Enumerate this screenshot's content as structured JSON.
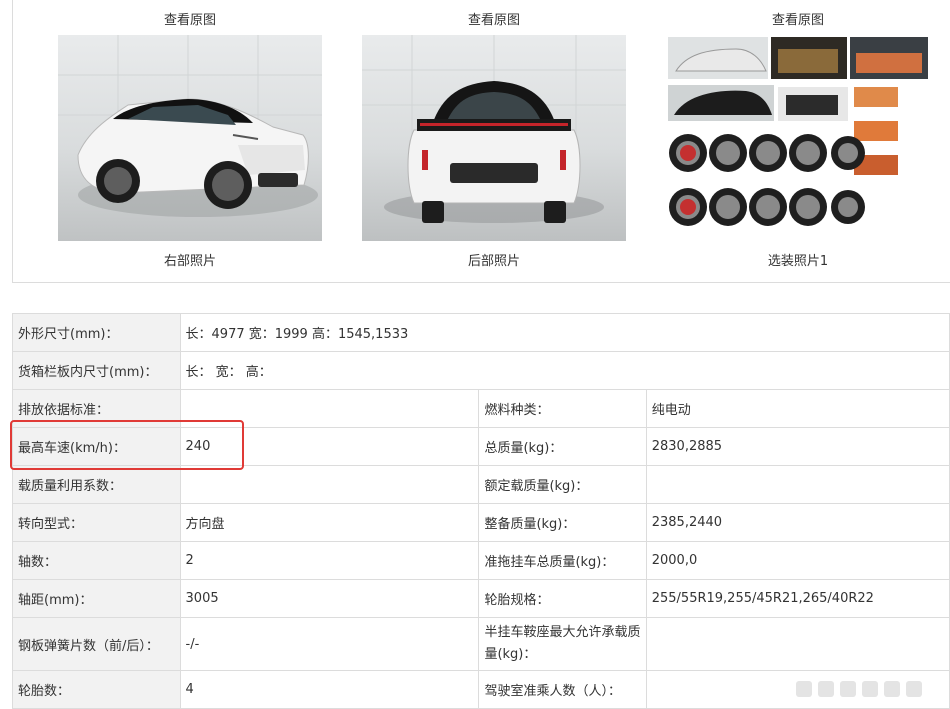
{
  "gallery": [
    {
      "view_link": "查看原图",
      "caption": "右部照片"
    },
    {
      "view_link": "查看原图",
      "caption": "后部照片"
    },
    {
      "view_link": "查看原图",
      "caption": "选装照片1"
    }
  ],
  "specs": {
    "rows": [
      {
        "l1": "外形尺寸(mm)：",
        "v1": "长：4977 宽：1999 高：1545,1533"
      },
      {
        "l1": "货箱栏板内尺寸(mm)：",
        "v1": "长： 宽： 高："
      },
      {
        "l1": "排放依据标准：",
        "v1": "",
        "l2": "燃料种类：",
        "v2": "纯电动"
      },
      {
        "l1": "最高车速(km/h)：",
        "v1": "240",
        "l2": "总质量(kg)：",
        "v2": "2830,2885"
      },
      {
        "l1": "载质量利用系数：",
        "v1": "",
        "l2": "额定载质量(kg)：",
        "v2": ""
      },
      {
        "l1": "转向型式：",
        "v1": "方向盘",
        "l2": "整备质量(kg)：",
        "v2": "2385,2440"
      },
      {
        "l1": "轴数：",
        "v1": "2",
        "l2": "准拖挂车总质量(kg)：",
        "v2": "2000,0"
      },
      {
        "l1": "轴距(mm)：",
        "v1": "3005",
        "l2": "轮胎规格：",
        "v2": "255/55R19,255/45R21,265/40R22"
      },
      {
        "l1": "钢板弹簧片数（前/后）：",
        "v1": "-/-",
        "l2": "半挂车鞍座最大允许承载质量(kg)：",
        "v2": ""
      },
      {
        "l1": "轮胎数：",
        "v1": "4",
        "l2": "驾驶室准乘人数（人）：",
        "v2": ""
      }
    ]
  },
  "colors": {
    "highlight": "#e03a36",
    "label_bg": "#f2f2f2",
    "border": "#dcdcdc"
  }
}
